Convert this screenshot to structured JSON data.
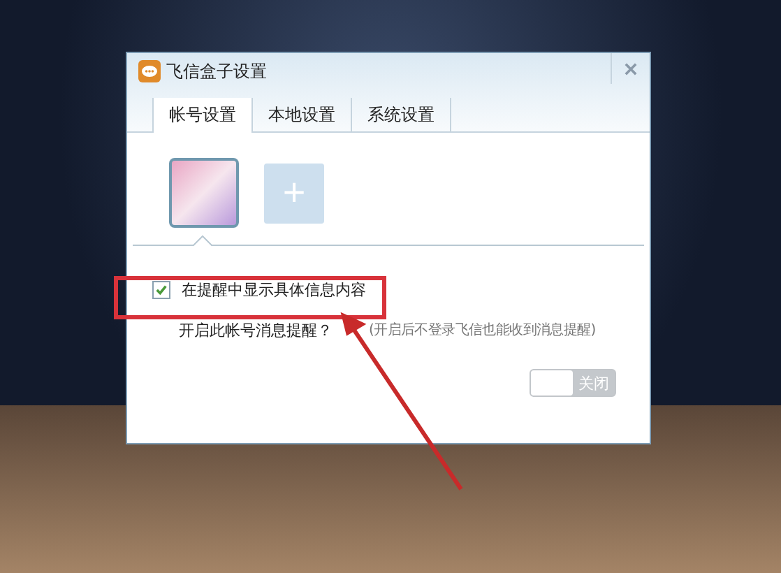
{
  "window": {
    "title": "飞信盒子设置"
  },
  "tabs": [
    {
      "label": "帐号设置",
      "selected": true
    },
    {
      "label": "本地设置",
      "selected": false
    },
    {
      "label": "系统设置",
      "selected": false
    }
  ],
  "add_account": {
    "label": "+"
  },
  "options": {
    "checkbox": {
      "label": "在提醒中显示具体信息内容",
      "checked": true
    },
    "question": "开启此帐号消息提醒？",
    "hint": "(开启后不登录飞信也能收到消息提醒)",
    "toggle": {
      "label": "关闭",
      "on": false
    }
  }
}
